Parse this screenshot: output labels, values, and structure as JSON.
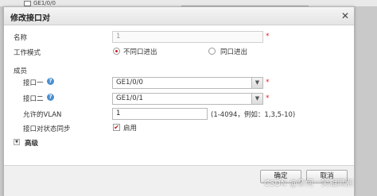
{
  "background": {
    "row_label": "GE1/0/0"
  },
  "dialog": {
    "title": "修改接口对",
    "close_glyph": "✕"
  },
  "form": {
    "name_label": "名称",
    "name_value": "1",
    "work_mode_label": "工作模式",
    "mode_options": [
      "不同口进出",
      "同口进出"
    ],
    "members_label": "成员",
    "port1_label": "接口一",
    "port1_value": "GE1/0/0",
    "port2_label": "接口二",
    "port2_value": "GE1/0/1",
    "vlan_label": "允许的VLAN",
    "vlan_value": "1",
    "vlan_hint": "(1-4094，例如：1,3,5-10)",
    "sync_label": "接口对状态同步",
    "sync_checkbox_label": "启用",
    "advanced_label": "高级",
    "required_mark": "*",
    "help_glyph": "?"
  },
  "buttons": {
    "ok": "确定",
    "cancel": "取消"
  },
  "watermark": "CSDN @奈何一笑相离别"
}
